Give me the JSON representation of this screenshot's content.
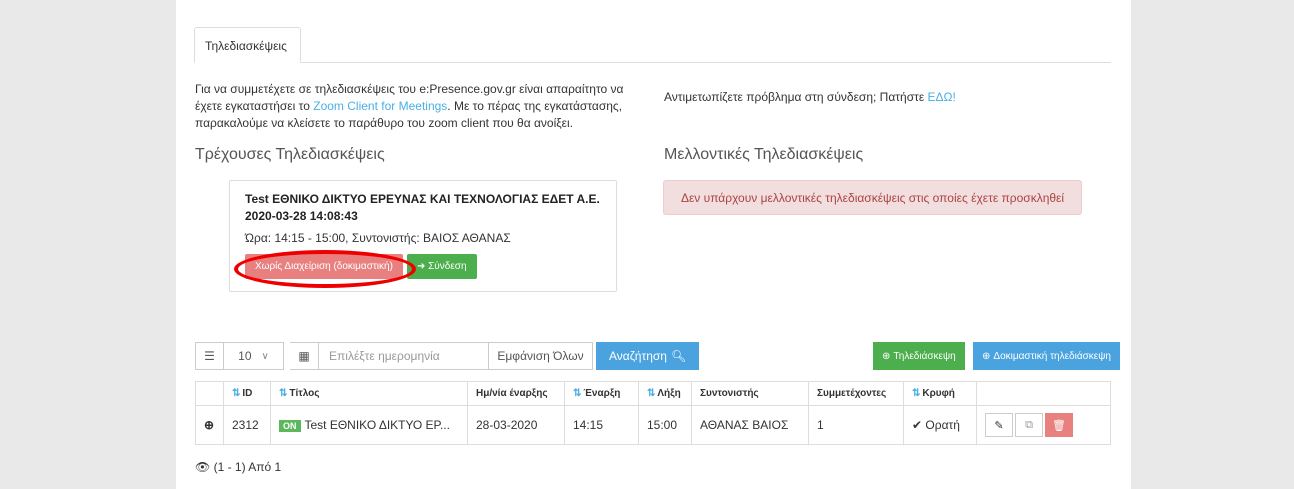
{
  "tab": {
    "label": "Τηλεδιασκέψεις"
  },
  "intro": {
    "part1": "Για να συμμετέχετε σε τηλεδιασκέψεις του e:Presence.gov.gr είναι απαραίτητο να έχετε εγκαταστήσει το ",
    "link": "Zoom Client for Meetings",
    "part2": ". Με το πέρας της εγκατάστασης, παρακαλούμε να κλείσετε το παράθυρο του zoom client που θα ανοίξει."
  },
  "problem": {
    "text": "Αντιμετωπίζετε πρόβλημα στη σύνδεση; Πατήστε ",
    "link": "ΕΔΩ!"
  },
  "current": {
    "title": "Τρέχουσες Τηλεδιασκέψεις",
    "card": {
      "title": "Test ΕΘΝΙΚΟ ΔΙΚΤΥΟ ΕΡΕΥΝΑΣ ΚΑΙ ΤΕΧΝΟΛΟΓΙΑΣ ΕΔΕΤ Α.Ε.",
      "datetime": "2020-03-28 14:08:43",
      "time": "Ώρα: 14:15 - 15:00, Συντονιστής: ΒΑΙΟΣ ΑΘΑΝΑΣ",
      "btn_manage": "Χωρίς Διαχείριση (δοκιμαστική)",
      "btn_connect": "Σύνδεση"
    }
  },
  "future": {
    "title": "Μελλοντικές Τηλεδιασκέψεις",
    "alert": "Δεν υπάρχουν μελλοντικές τηλεδιασκέψεις στις οποίες έχετε προσκληθεί"
  },
  "toolbar": {
    "page_size": "10",
    "date_placeholder": "Επιλέξτε ημερομηνία",
    "show_all": "Εμφάνιση Όλων",
    "search": "Αναζήτηση",
    "add_conf": "Τηλεδιάσκεψη",
    "add_test_conf": "Δοκιμαστική τηλεδιάσκεψη"
  },
  "table": {
    "headers": [
      "ID",
      "Τίτλος",
      "Ημ/νία έναρξης",
      "Έναρξη",
      "Λήξη",
      "Συντονιστής",
      "Συμμετέχοντες",
      "Κρυφή"
    ],
    "row": {
      "id": "2312",
      "badge": "ON",
      "title": "Test ΕΘΝΙΚΟ ΔΙΚΤΥΟ ΕΡ...",
      "date": "28-03-2020",
      "start": "14:15",
      "end": "15:00",
      "coordinator": "ΑΘΑΝΑΣ ΒΑΙΟΣ",
      "participants": "1",
      "visibility": "Ορατή"
    }
  },
  "footer": {
    "text": "(1 - 1) Από 1"
  },
  "colors": {
    "accent": "#4ab0e4",
    "danger": "#e88080",
    "success": "#4cae4c",
    "highlight": "#ee0000"
  }
}
